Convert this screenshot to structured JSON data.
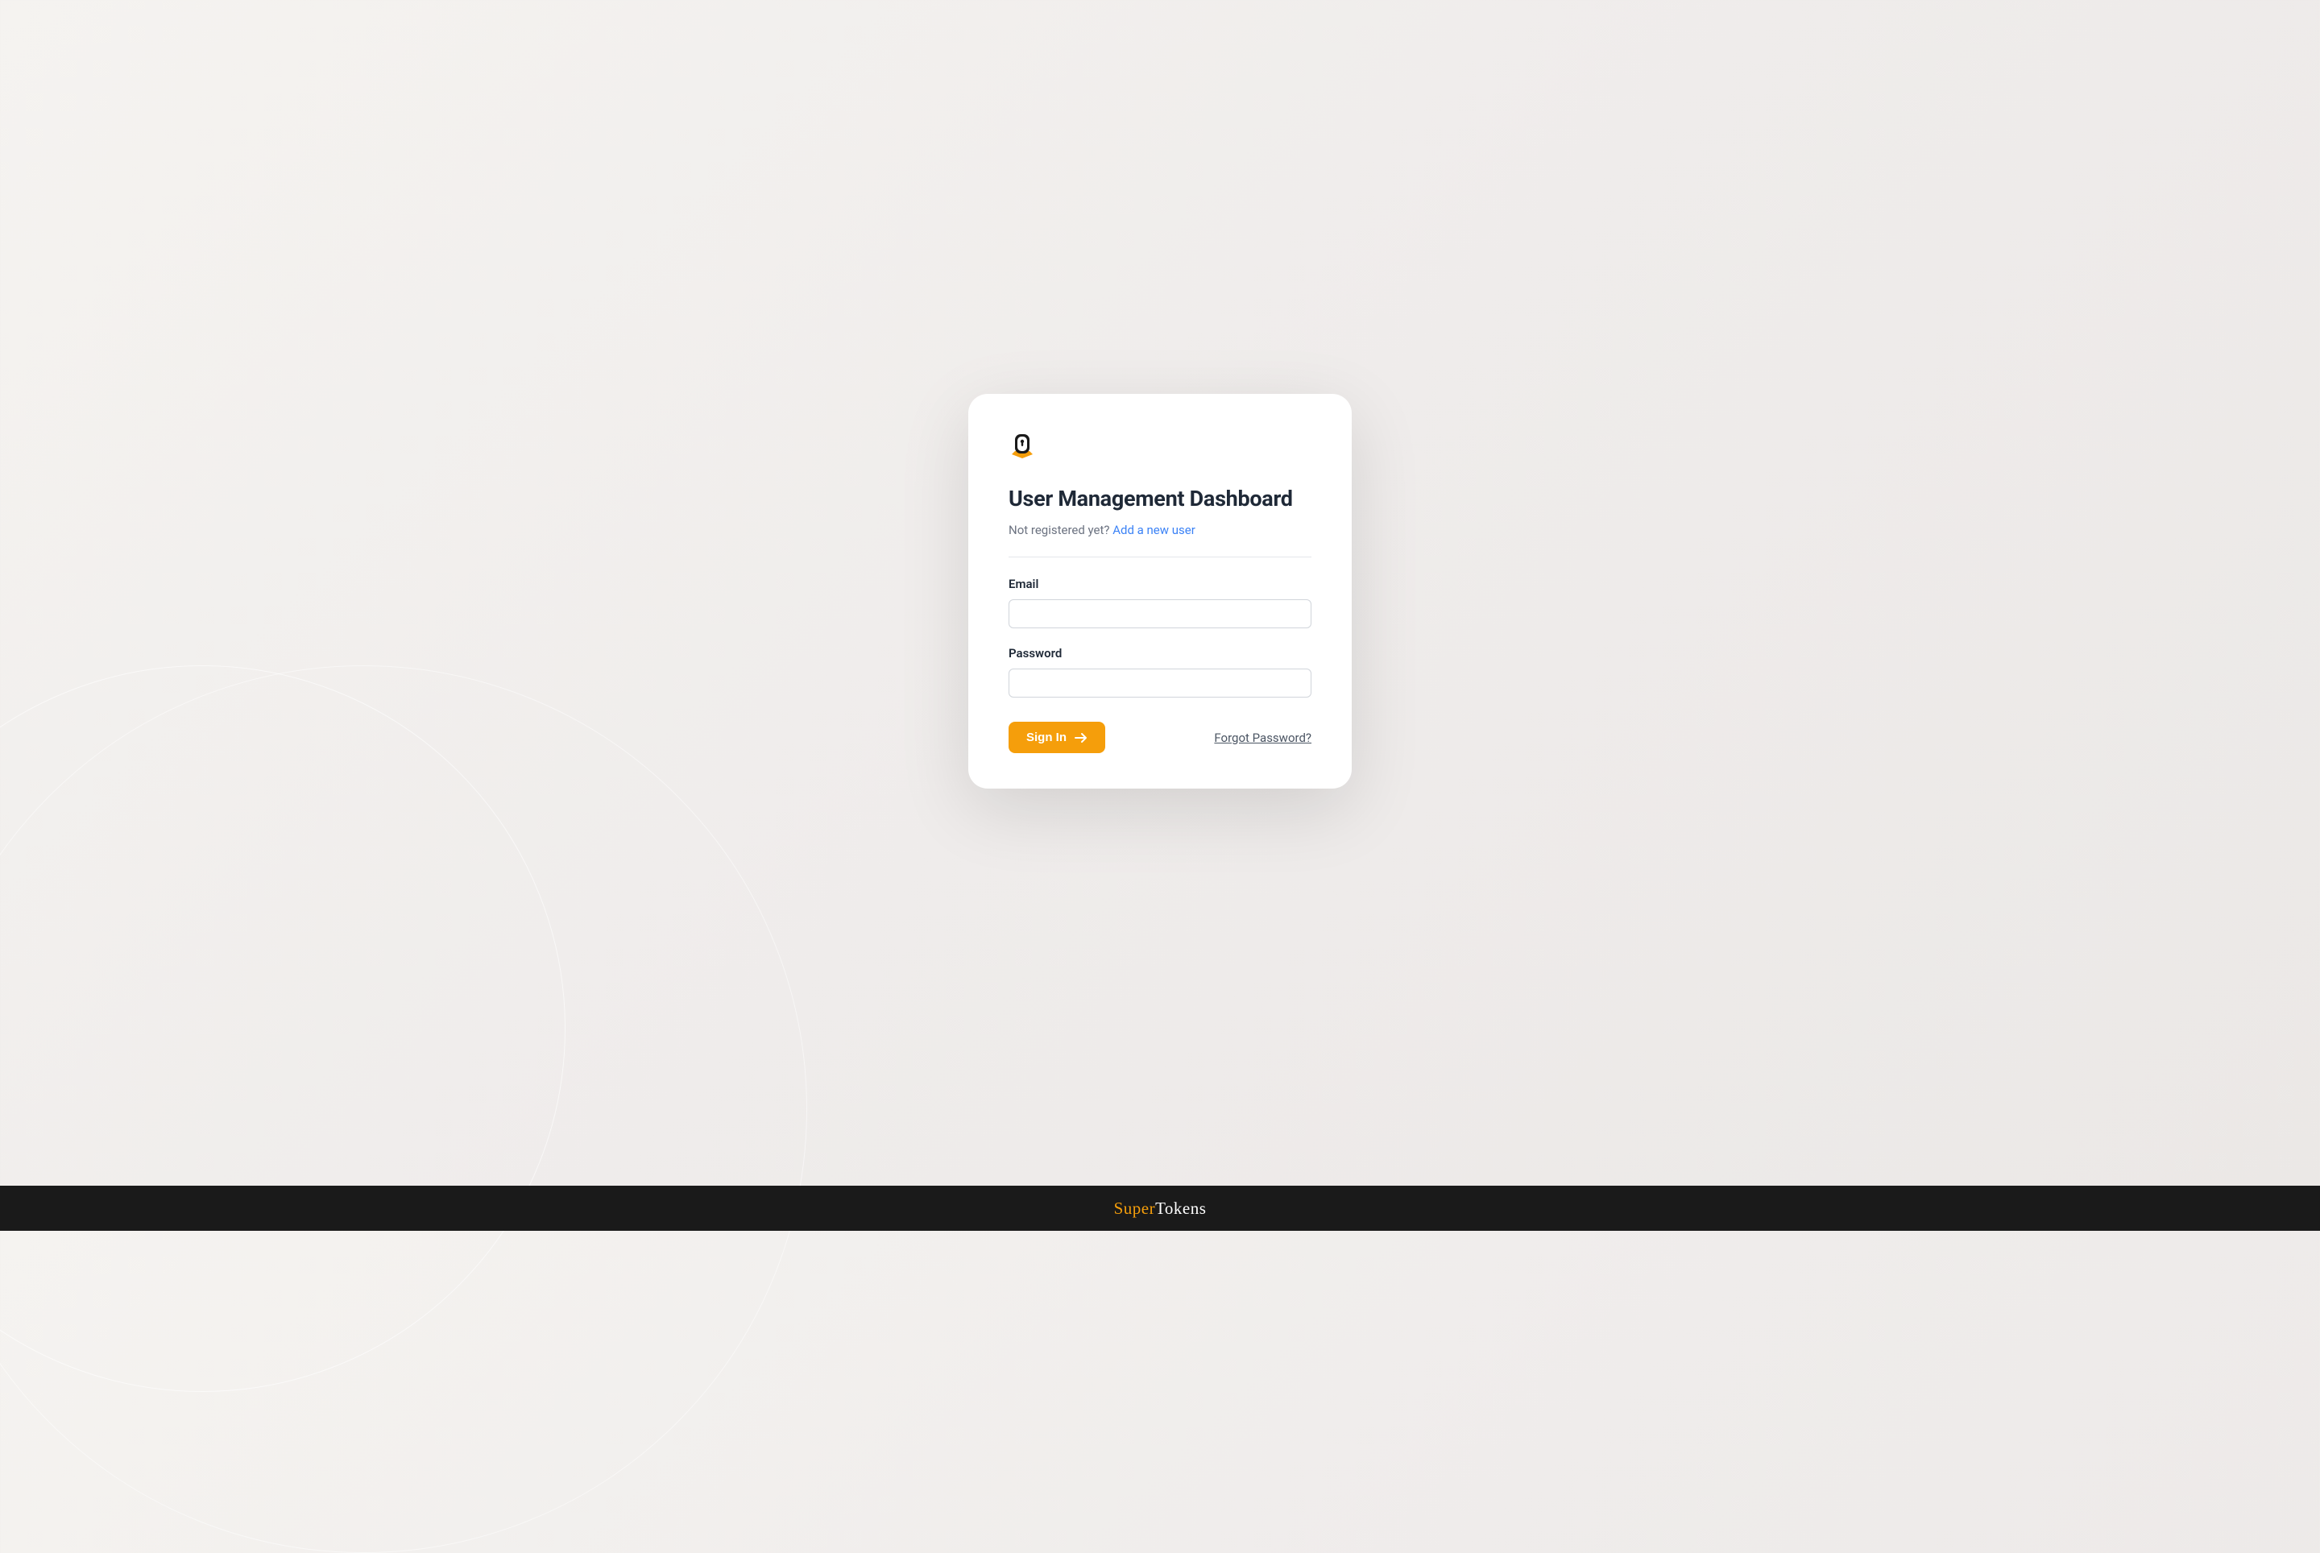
{
  "card": {
    "title": "User Management Dashboard",
    "register_prefix": "Not registered yet? ",
    "register_link": "Add a new user"
  },
  "form": {
    "email_label": "Email",
    "email_value": "",
    "password_label": "Password",
    "password_value": ""
  },
  "actions": {
    "signin_label": "Sign In",
    "forgot_label": "Forgot Password?"
  },
  "footer": {
    "brand_first": "Super",
    "brand_second": "Tokens"
  }
}
